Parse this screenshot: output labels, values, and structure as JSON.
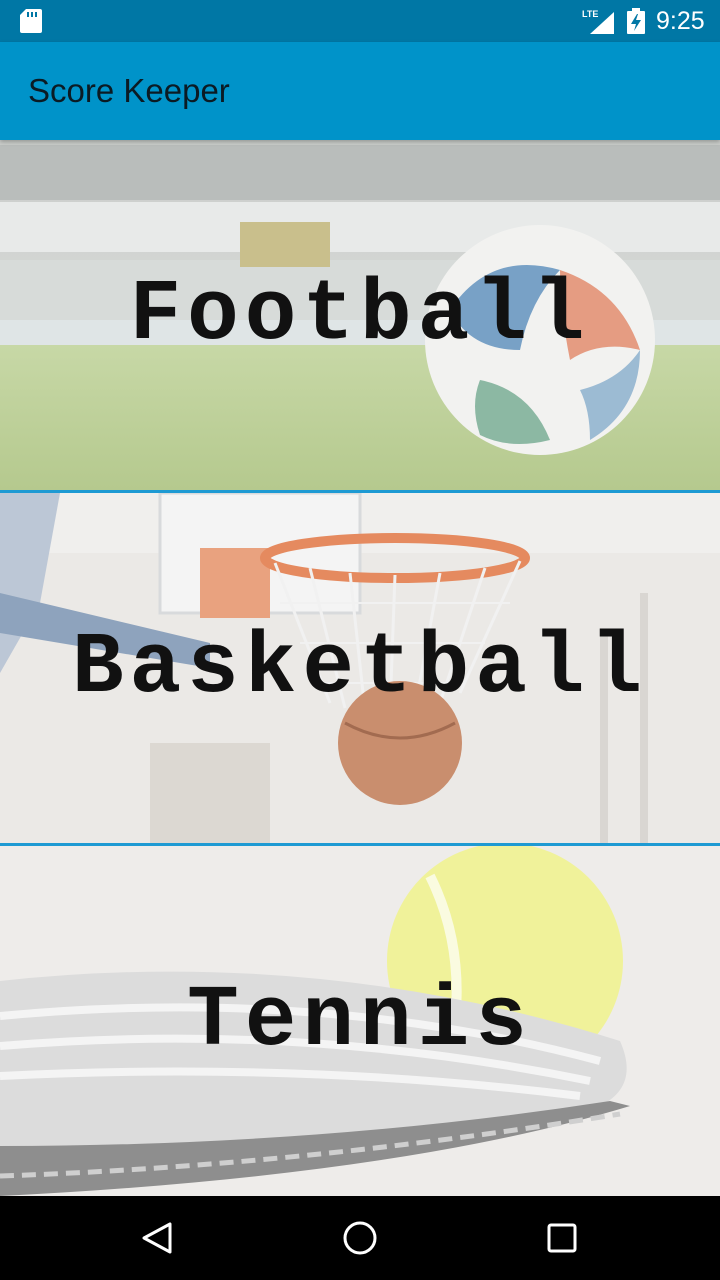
{
  "status_bar": {
    "time": "9:25",
    "network": "LTE",
    "icons": [
      "sd-card-icon",
      "lte-signal-icon",
      "battery-charging-icon"
    ]
  },
  "app_bar": {
    "title": "Score Keeper",
    "color": "#0093c9"
  },
  "sports": [
    {
      "label": "Football",
      "image": "football-on-grass"
    },
    {
      "label": "Basketball",
      "image": "basketball-hoop"
    },
    {
      "label": "Tennis",
      "image": "tennis-ball-on-racket"
    }
  ],
  "nav_bar": {
    "buttons": [
      "back-icon",
      "home-icon",
      "recents-icon"
    ]
  },
  "colors": {
    "status_bar": "#0077a5",
    "divider": "#1e9ad3"
  }
}
